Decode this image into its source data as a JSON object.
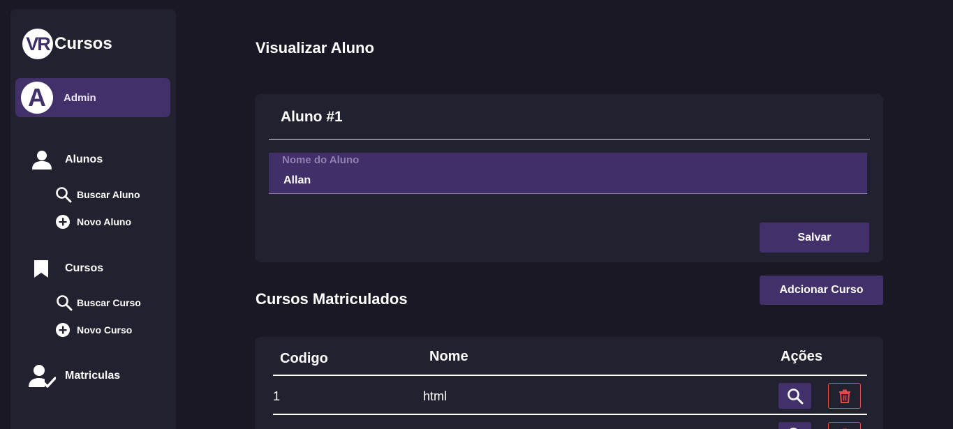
{
  "app": {
    "logo_mark": "VR",
    "logo_text": "Cursos"
  },
  "user": {
    "avatar_letter": "A",
    "name": "Admin"
  },
  "sidebar": {
    "sections": [
      {
        "label": "Alunos",
        "icon": "person-icon"
      },
      {
        "label": "Cursos",
        "icon": "bookmark-icon"
      },
      {
        "label": "Matriculas",
        "icon": "person-check-icon"
      }
    ],
    "alunos_items": [
      {
        "label": "Buscar Aluno",
        "icon": "search-icon"
      },
      {
        "label": "Novo Aluno",
        "icon": "plus-circle-icon"
      }
    ],
    "cursos_items": [
      {
        "label": "Buscar Curso",
        "icon": "search-icon"
      },
      {
        "label": "Novo Curso",
        "icon": "plus-circle-icon"
      }
    ]
  },
  "main": {
    "page_title": "Visualizar Aluno",
    "card_title": "Aluno #1",
    "name_field": {
      "label": "Nome do Aluno",
      "value": "Allan"
    },
    "save_label": "Salvar",
    "section_title": "Cursos Matriculados",
    "add_course_label": "Adcionar Curso",
    "table": {
      "headers": [
        "Codigo",
        "Nome",
        "Ações"
      ],
      "rows": [
        {
          "codigo": "1",
          "nome": "html"
        }
      ]
    }
  },
  "colors": {
    "background": "#1b1825",
    "panel": "#22212f",
    "accent": "#42306a",
    "danger": "#e5484d"
  }
}
